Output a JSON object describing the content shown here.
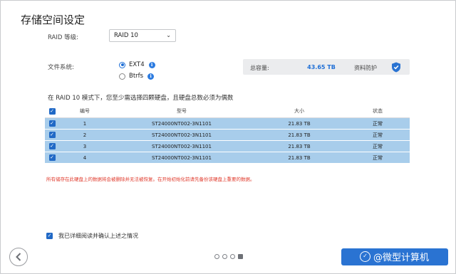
{
  "title": "存储空间设定",
  "raid": {
    "label": "RAID 等级:",
    "selected": "RAID 10"
  },
  "filesystem": {
    "label": "文件系统:",
    "options": [
      {
        "label": "EXT4",
        "selected": true
      },
      {
        "label": "Btrfs",
        "selected": false
      }
    ]
  },
  "capacity": {
    "label": "总容量:",
    "value": "43.65 TB",
    "protection_label": "资料防护"
  },
  "note": "在 RAID 10 模式下，您至少需选择四颗硬盘，且硬盘总数必须为偶数",
  "table": {
    "headers": [
      "编号",
      "型号",
      "大小",
      "状态"
    ],
    "rows": [
      {
        "num": "1",
        "model": "ST24000NT002-3N1101",
        "size": "21.83 TB",
        "status": "正常"
      },
      {
        "num": "2",
        "model": "ST24000NT002-3N1101",
        "size": "21.83 TB",
        "status": "正常"
      },
      {
        "num": "3",
        "model": "ST24000NT002-3N1101",
        "size": "21.83 TB",
        "status": "正常"
      },
      {
        "num": "4",
        "model": "ST24000NT002-3N1101",
        "size": "21.83 TB",
        "status": "正常"
      }
    ]
  },
  "warning": "所有储存在此硬盘上的数据将会被删除并无法被恢复。在开始初始化前请先备份该硬盘上重要的数据。",
  "acknowledge": "我已详细阅读并确认上述之情况",
  "pagination": {
    "total": 4,
    "current": 4
  },
  "watermark": "@微型计算机",
  "colors": {
    "accent": "#2a73d2",
    "row_selected": "#a8cdeb",
    "warning": "#e0392b"
  }
}
